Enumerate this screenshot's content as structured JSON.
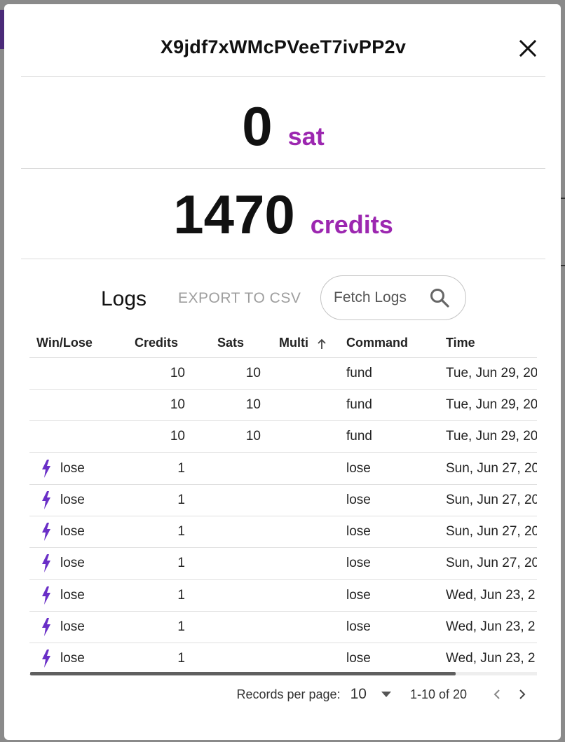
{
  "modal": {
    "title": "X9jdf7xWMcPVeeT7ivPP2v"
  },
  "balances": {
    "sat_value": "0",
    "sat_unit": "sat",
    "credits_value": "1470",
    "credits_unit": "credits"
  },
  "logs": {
    "title": "Logs",
    "export_label": "EXPORT TO CSV",
    "fetch_label": "Fetch Logs"
  },
  "table": {
    "headers": {
      "win_lose": "Win/Lose",
      "credits": "Credits",
      "sats": "Sats",
      "multi": "Multi",
      "command": "Command",
      "time": "Time"
    },
    "rows": [
      {
        "win_lose": "",
        "credits": "10",
        "sats": "10",
        "multi": "",
        "command": "fund",
        "time": "Tue, Jun 29, 20"
      },
      {
        "win_lose": "",
        "credits": "10",
        "sats": "10",
        "multi": "",
        "command": "fund",
        "time": "Tue, Jun 29, 20"
      },
      {
        "win_lose": "",
        "credits": "10",
        "sats": "10",
        "multi": "",
        "command": "fund",
        "time": "Tue, Jun 29, 20"
      },
      {
        "win_lose": "lose",
        "credits": "1",
        "sats": "",
        "multi": "",
        "command": "lose",
        "time": "Sun, Jun 27, 20"
      },
      {
        "win_lose": "lose",
        "credits": "1",
        "sats": "",
        "multi": "",
        "command": "lose",
        "time": "Sun, Jun 27, 20"
      },
      {
        "win_lose": "lose",
        "credits": "1",
        "sats": "",
        "multi": "",
        "command": "lose",
        "time": "Sun, Jun 27, 20"
      },
      {
        "win_lose": "lose",
        "credits": "1",
        "sats": "",
        "multi": "",
        "command": "lose",
        "time": "Sun, Jun 27, 20"
      },
      {
        "win_lose": "lose",
        "credits": "1",
        "sats": "",
        "multi": "",
        "command": "lose",
        "time": "Wed, Jun 23, 2"
      },
      {
        "win_lose": "lose",
        "credits": "1",
        "sats": "",
        "multi": "",
        "command": "lose",
        "time": "Wed, Jun 23, 2"
      },
      {
        "win_lose": "lose",
        "credits": "1",
        "sats": "",
        "multi": "",
        "command": "lose",
        "time": "Wed, Jun 23, 2"
      }
    ]
  },
  "pagination": {
    "rpp_label": "Records per page:",
    "rpp_value": "10",
    "range": "1-10 of 20"
  },
  "icons": {
    "close": "close-icon",
    "search": "search-icon",
    "sort": "arrow-up-icon",
    "win_lose": "lightning-bolt-icon",
    "prev": "chevron-left-icon",
    "next": "chevron-right-icon",
    "dropdown": "caret-down-icon"
  },
  "colors": {
    "accent": "#9c27b0",
    "bolt": "#6a2fc7"
  }
}
